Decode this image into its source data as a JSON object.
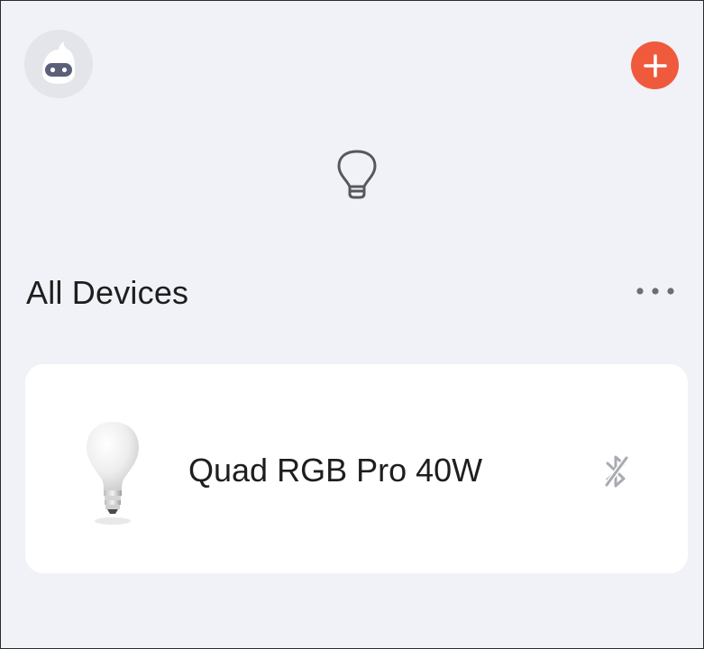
{
  "header": {
    "avatar_icon": "robot-avatar-icon",
    "add_icon": "plus-icon",
    "add_color": "#ef5a3c"
  },
  "hero": {
    "icon": "lightbulb-outline-icon"
  },
  "section": {
    "title": "All Devices",
    "more_icon": "more-horizontal-icon"
  },
  "devices": [
    {
      "name": "Quad RGB Pro 40W",
      "image_icon": "light-bulb-image",
      "status_icon": "bluetooth-disconnected-icon"
    }
  ],
  "colors": {
    "background": "#f0f2f7",
    "card": "#ffffff",
    "text": "#1e1e1e"
  }
}
